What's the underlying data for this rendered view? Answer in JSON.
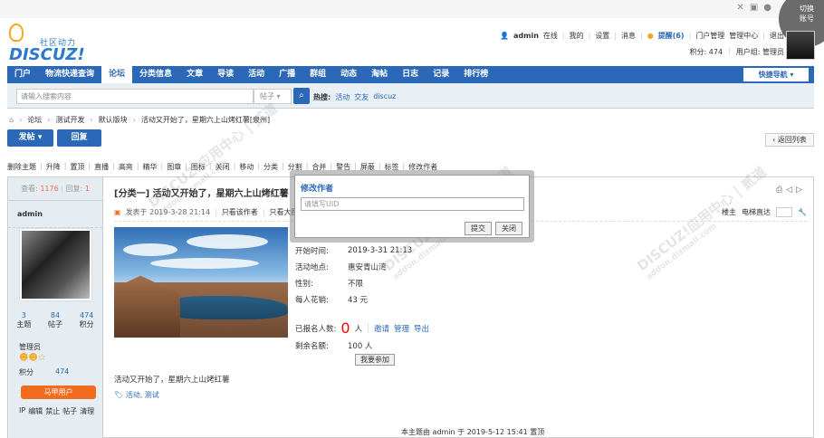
{
  "chrome": {
    "switch_account": "切换\n账号",
    "icons": [
      "✕",
      "▣",
      "●"
    ]
  },
  "header": {
    "logo_slogan": "社区动力",
    "logo_brand": "DISCUZ!",
    "user": "admin",
    "online": "在线",
    "my": "我的",
    "settings": "设置",
    "messages": "消息",
    "remind": "提醒(6)",
    "portal_manage": "门户管理",
    "admin_manage": "管理中心",
    "logout": "退出",
    "credits": "积分: 474",
    "usergroup": "用户组: 管理员"
  },
  "nav": {
    "items": [
      "门户",
      "物流快递查询",
      "论坛",
      "分类信息",
      "文章",
      "导读",
      "活动",
      "广播",
      "群组",
      "动态",
      "淘帖",
      "日志",
      "记录",
      "排行榜"
    ],
    "quick_nav": "快捷导航"
  },
  "search": {
    "placeholder": "请输入搜索内容",
    "type": "帖子",
    "hot_label": "热搜:",
    "hot_items": [
      "活动",
      "交友",
      "discuz"
    ]
  },
  "breadcrumb": [
    "论坛",
    "测试开发",
    "默认版块",
    "活动又开始了，星期六上山烤红薯[泉州]"
  ],
  "actions": {
    "post": "发帖",
    "reply": "回复",
    "back_list": "返回列表"
  },
  "modbar": [
    "删除主题",
    "升降",
    "置顶",
    "直播",
    "高亮",
    "精华",
    "图章",
    "图标",
    "关闭",
    "移动",
    "分类",
    "分割",
    "合并",
    "警告",
    "屏蔽",
    "标签",
    "修改作者"
  ],
  "thread": {
    "views_label": "查看:",
    "views": "1176",
    "replies_label": "回复:",
    "replies": "1",
    "author": "admin",
    "stats": [
      {
        "n": "3",
        "label": "主题"
      },
      {
        "n": "84",
        "label": "帖子"
      },
      {
        "n": "474",
        "label": "积分"
      }
    ],
    "role": "管理员",
    "credit_label": "积分",
    "credit_value": "474",
    "magic_btn": "马甲用户",
    "ops": [
      "IP",
      "编辑",
      "禁止",
      "帖子",
      "清理"
    ],
    "title": "[分类一] 活动又开始了，星期六上山烤红薯",
    "posted": "发表于 2019-3-28 21:14",
    "only_author": "只看该作者",
    "only_image": "只看大图",
    "floor": "楼主",
    "elevator": "电梯直达",
    "activity": [
      {
        "k": "开始时间:",
        "v": "2019-3-31 21:13"
      },
      {
        "k": "活动地点:",
        "v": "惠安青山湾"
      },
      {
        "k": "性别:",
        "v": "不限"
      },
      {
        "k": "每人花销:",
        "v": "43 元"
      }
    ],
    "applied_label": "已报名人数:",
    "applied_count": "0",
    "applied_unit": "人",
    "invite": "邀请",
    "manage": "管理",
    "export": "导出",
    "remain_label": "剩余名额:",
    "remain_value": "100 人",
    "join_btn": "我要参加",
    "body": "活动又开始了，星期六上山烤红薯",
    "tags": "活动, 测试",
    "bumped": "本主题由 admin 于 2019-5-12 15:41 置顶"
  },
  "modal": {
    "title": "修改作者",
    "placeholder": "请填写UID",
    "ok": "提交",
    "close": "关闭"
  },
  "watermark": {
    "brand": "DISCUZ!应用中心 | 贰道",
    "url": "addon.dismall.com"
  }
}
